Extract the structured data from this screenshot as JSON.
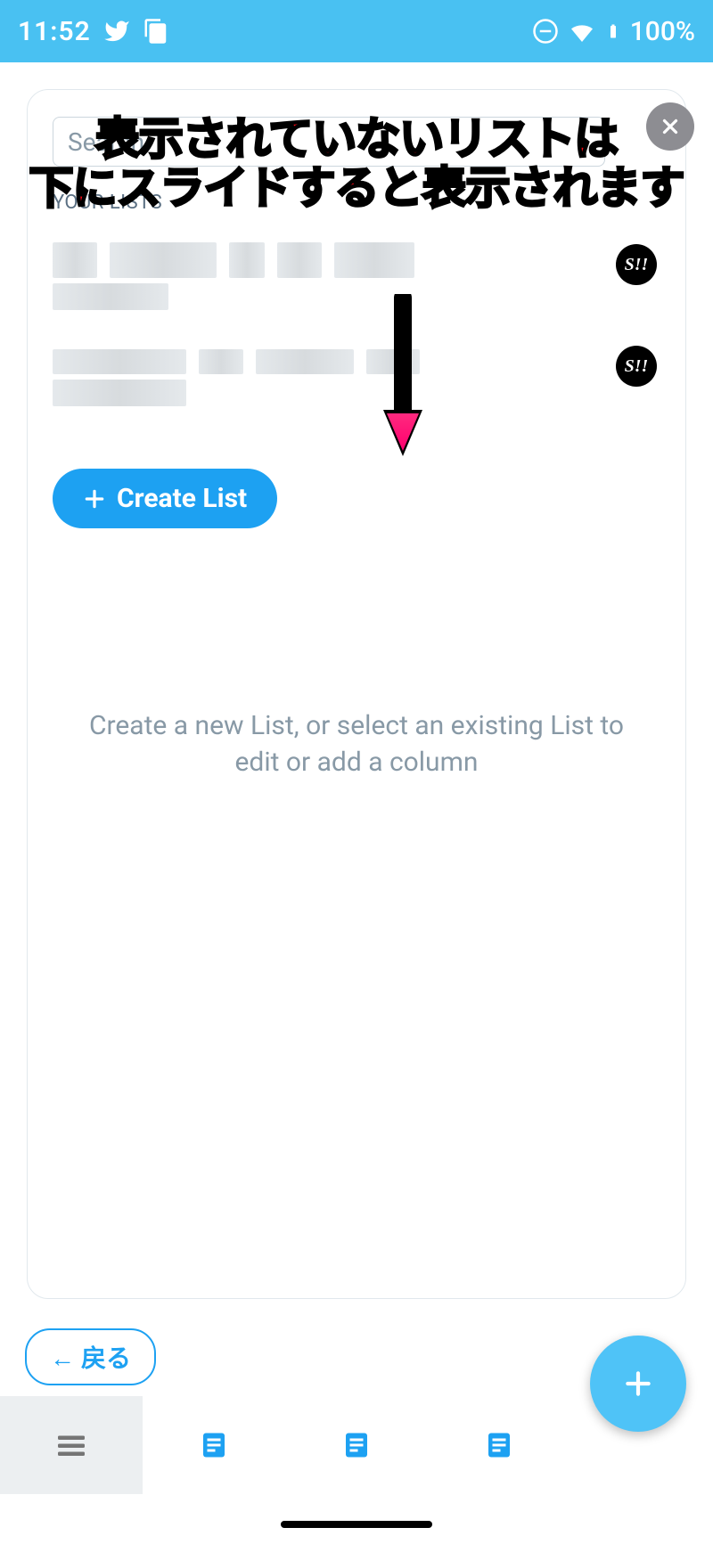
{
  "status": {
    "time": "11:52",
    "battery_pct": "100%"
  },
  "modal": {
    "search_placeholder": "Search",
    "section_label": "YOUR LISTS",
    "badge_label": "S!!",
    "create_list_label": "Create List",
    "hint_text_line1": "Create a new List, or select an existing List to",
    "hint_text_line2": "edit or add a column"
  },
  "annotation": {
    "line1": "表示されていないリストは",
    "line2": "下にスライドすると表示されます"
  },
  "back_button_label": "← 戻る",
  "fab_label": "+"
}
